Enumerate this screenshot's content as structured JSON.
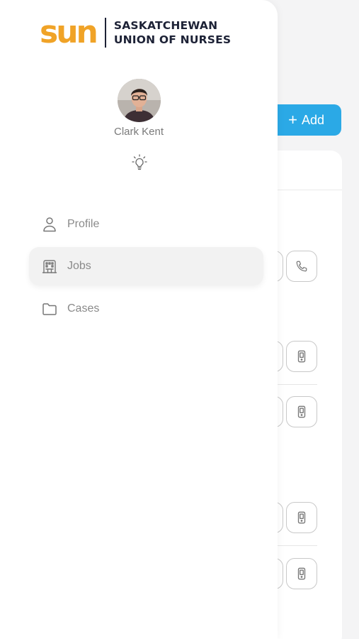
{
  "brand": {
    "mark": "sun",
    "line1": "SASKATCHEWAN",
    "line2": "UNION OF NURSES",
    "accent_color": "#f0a327",
    "text_color": "#1d2236"
  },
  "user": {
    "name": "Clark Kent"
  },
  "nav": {
    "items": [
      {
        "label": "Profile",
        "icon": "person-icon",
        "active": false
      },
      {
        "label": "Jobs",
        "icon": "building-icon",
        "active": true
      },
      {
        "label": "Cases",
        "icon": "folder-icon",
        "active": false
      }
    ]
  },
  "background": {
    "add_label": "Add",
    "add_color": "#2ba9e6"
  }
}
